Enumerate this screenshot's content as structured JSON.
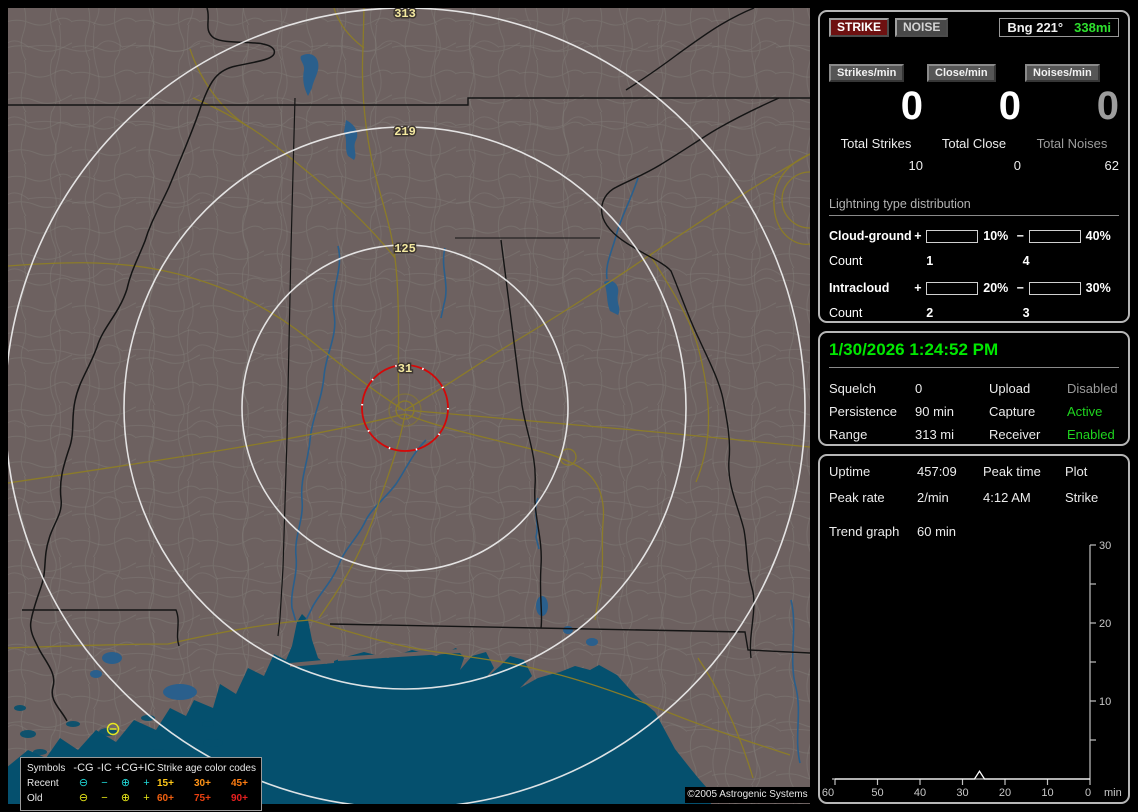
{
  "header": {
    "strike_button": "STRIKE",
    "noise_button": "NOISE",
    "bearing_label": "Bng 221°",
    "bearing_distance": "338mi"
  },
  "stats": {
    "columns": [
      {
        "rate_label": "Strikes/min",
        "rate_value": "0",
        "total_label": "Total Strikes",
        "total_value": "10"
      },
      {
        "rate_label": "Close/min",
        "rate_value": "0",
        "total_label": "Total Close",
        "total_value": "0"
      },
      {
        "rate_label": "Noises/min",
        "rate_value": "0",
        "total_label": "Total Noises",
        "total_value": "62"
      }
    ]
  },
  "distribution": {
    "title": "Lightning type distribution",
    "plus": "+",
    "minus": "−",
    "count_label": "Count",
    "rows": [
      {
        "name": "Cloud-ground",
        "pos_pct": "10%",
        "pos_fill": 10,
        "pos_color": "#f00000",
        "neg_pct": "40%",
        "neg_fill": 40,
        "neg_color": "#8ec6f0",
        "pos_count": "1",
        "neg_count": "4"
      },
      {
        "name": "Intracloud",
        "pos_pct": "20%",
        "pos_fill": 20,
        "pos_color": "#f07ad0",
        "neg_pct": "30%",
        "neg_fill": 30,
        "neg_color": "#22dd22",
        "pos_count": "2",
        "neg_count": "3"
      }
    ]
  },
  "status": {
    "datetime": "1/30/2026 1:24:52 PM",
    "rows": [
      [
        "Squelch",
        "0",
        "Upload",
        "Disabled"
      ],
      [
        "Persistence",
        "90 min",
        "Capture",
        "Active"
      ],
      [
        "Range",
        "313 mi",
        "Receiver",
        "Enabled"
      ]
    ]
  },
  "uptime": {
    "rows": [
      [
        "Uptime",
        "457:09",
        "Peak time",
        "Plot"
      ],
      [
        "Peak rate",
        "2/min",
        "4:12 AM",
        "Strike"
      ]
    ],
    "trend_label": "Trend graph",
    "trend_value": "60 min"
  },
  "trend": {
    "chart_data": {
      "type": "line",
      "title": "Strike trend, last 60 minutes",
      "xlabel": "min",
      "x_ticks": [
        60,
        50,
        40,
        30,
        20,
        10,
        0
      ],
      "y_ticks": [
        30,
        20,
        10
      ],
      "ylim": [
        0,
        30
      ],
      "xlim_minutes_ago": [
        60,
        0
      ],
      "baseline": 0,
      "points": [
        {
          "minutes_ago": 26,
          "value": 1
        }
      ]
    }
  },
  "map": {
    "rings": [
      {
        "label": "313",
        "radius_mi": 313
      },
      {
        "label": "219",
        "radius_mi": 219
      },
      {
        "label": "125",
        "radius_mi": 125
      },
      {
        "label": "31",
        "radius_mi": 31
      }
    ],
    "close_ring_color": "#d40808",
    "strike_markers": [
      {
        "symbol": "⊖",
        "age": "old",
        "type": "-CG"
      }
    ],
    "copyright": "©2005 Astrogenic Systems"
  },
  "legend": {
    "header": {
      "symbols": "Symbols",
      "neg_cg": "-CG",
      "neg_ic": "-IC",
      "pos_cg": "+CG",
      "pos_ic": "+IC",
      "age_title": "Strike age color codes"
    },
    "rows": [
      {
        "label": "Recent",
        "color": "#20d8d8",
        "symbols": [
          "⊖",
          "−",
          "⊕",
          "+"
        ],
        "ages": [
          {
            "text": "15+",
            "color": "#ffc818"
          },
          {
            "text": "30+",
            "color": "#ff9418"
          },
          {
            "text": "45+",
            "color": "#ff7c10"
          }
        ]
      },
      {
        "label": "Old",
        "color": "#e8e818",
        "symbols": [
          "⊖",
          "−",
          "⊕",
          "+"
        ],
        "ages": [
          {
            "text": "60+",
            "color": "#f06010"
          },
          {
            "text": "75+",
            "color": "#e84010"
          },
          {
            "text": "90+",
            "color": "#e82020"
          }
        ]
      }
    ]
  }
}
